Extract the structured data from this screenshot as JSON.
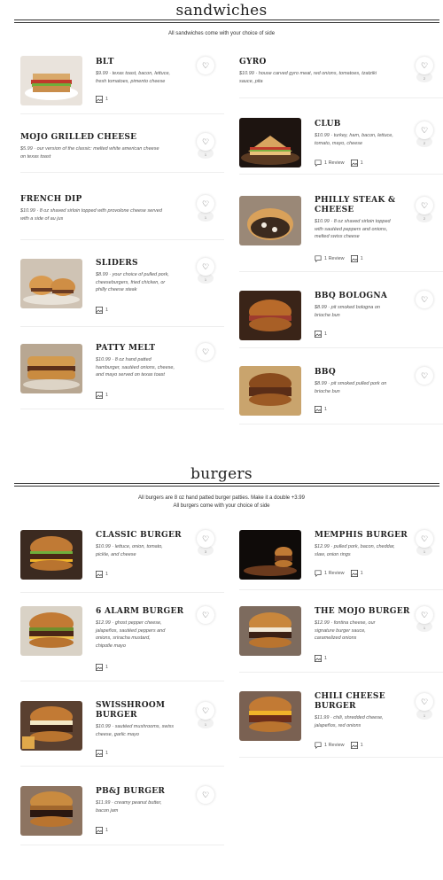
{
  "sections": {
    "sandwiches": {
      "title": "sandwiches",
      "note": "All sandwiches come with your choice of side",
      "items": [
        {
          "name": "BLT",
          "desc1": "$9.99 · texas toast, bacon, lettuce,",
          "desc2": "fresh tomatoes, pimento cheese",
          "photos": "1"
        },
        {
          "name": "GYRO",
          "desc1": "$10.99 · house carved gyro meat, red onions, tomatoes, tzatziki",
          "desc2": "sauce, pita",
          "count": "2"
        },
        {
          "name": "MOJO GRILLED CHEESE",
          "desc1": "$5.99 · our version of the classic: melted white american cheese",
          "desc2": "on texas toast",
          "count": "1"
        },
        {
          "name": "CLUB",
          "desc1": "$10.99 · turkey, ham, bacon, lettuce,",
          "desc2": "tomato, mayo, cheese",
          "reviews": "1 Review",
          "photos": "1",
          "count": "2"
        },
        {
          "name": "FRENCH DIP",
          "desc1": "$10.99 · 8 oz shaved sirloin topped with provolone cheese served",
          "desc2": "with a side of au jus",
          "count": "1"
        },
        {
          "name": "PHILLY STEAK & CHEESE",
          "desc1": "$10.99 · 8 oz shaved sirloin topped",
          "desc2": "with sautéed peppers and onions,",
          "desc3": "melted swiss cheese",
          "reviews": "1 Review",
          "photos": "1",
          "count": "2"
        },
        {
          "name": "SLIDERS",
          "desc1": "$8.99 · your choice of pulled pork,",
          "desc2": "cheeseburgers, fried chicken, or",
          "desc3": "philly cheese steak",
          "photos": "1",
          "count": "1"
        },
        {
          "name": "BBQ BOLOGNA",
          "desc1": "$8.99 · pit smoked bologna on",
          "desc2": "brioche bun",
          "photos": "1"
        },
        {
          "name": "PATTY MELT",
          "desc1": "$10.99 · 8 oz hand patted",
          "desc2": "hamburger, sautéed onions, cheese,",
          "desc3": "and mayo served on texas toast",
          "photos": "1"
        },
        {
          "name": "BBQ",
          "desc1": "$8.99 · pit smoked pulled pork on",
          "desc2": "brioche bun",
          "photos": "1"
        }
      ]
    },
    "burgers": {
      "title": "burgers",
      "note1": "All burgers are 8 oz hand patted burger patties. Make it a double +3.99",
      "note2": "All burgers come with your choice of side",
      "items": [
        {
          "name": "CLASSIC BURGER",
          "desc1": "$10.99 · lettuce, onion, tomato,",
          "desc2": "pickle, and cheese",
          "photos": "1",
          "count": "3"
        },
        {
          "name": "MEMPHIS BURGER",
          "desc1": "$12.99 · pulled pork, bacon, cheddar,",
          "desc2": "slaw, onion rings",
          "reviews": "1 Review",
          "photos": "1",
          "count": "1"
        },
        {
          "name": "6 ALARM BURGER",
          "desc1": "$12.99 · ghost pepper cheese,",
          "desc2": "jalapeños, sautéed peppers and",
          "desc3": "onions, sriracha mustard,",
          "desc4": "chipotle mayo",
          "photos": "1"
        },
        {
          "name": "THE MOJO BURGER",
          "desc1": "$12.99 · fontina cheese, our",
          "desc2": "signature burger sauce,",
          "desc3": "caramelized onions",
          "photos": "1",
          "count": "1"
        },
        {
          "name": "SWISSHROOM BURGER",
          "desc1": "$10.99 · sautéed mushrooms, swiss",
          "desc2": "cheese, garlic mayo",
          "photos": "1",
          "count": "1"
        },
        {
          "name": "CHILI CHEESE BURGER",
          "desc1": "$11.99 · chili, shredded cheese,",
          "desc2": "jalapeños, red onions",
          "reviews": "1 Review",
          "photos": "1",
          "count": "1"
        },
        {
          "name": "PB&J BURGER",
          "desc1": "$11.99 · creamy peanut butter,",
          "desc2": "bacon jam",
          "photos": "1"
        }
      ]
    }
  },
  "icons": {
    "favorite": "heart-icon",
    "photo": "image-icon",
    "review": "chat-bubble-icon"
  }
}
